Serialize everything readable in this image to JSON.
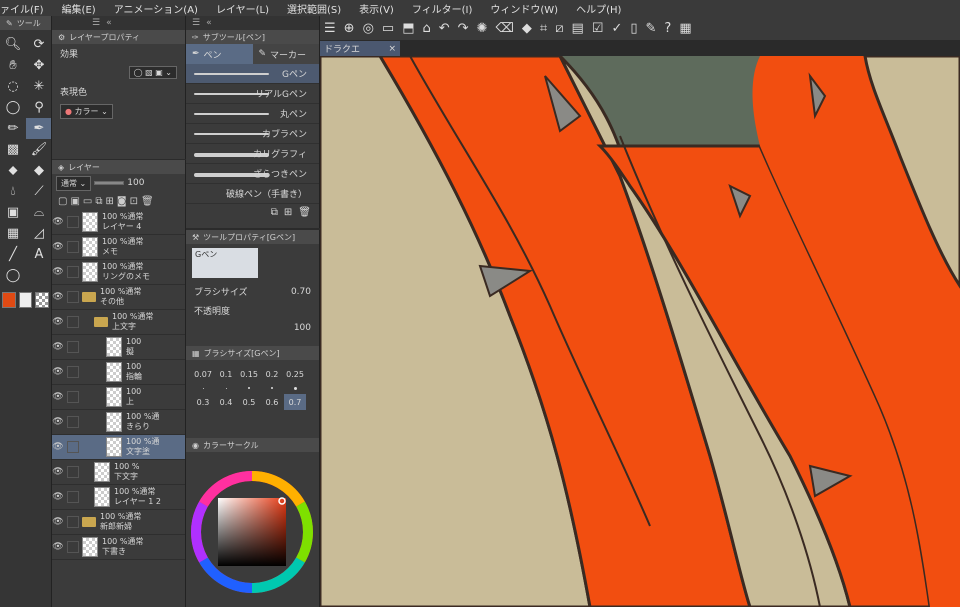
{
  "menu": [
    "ァイル(F)",
    "編集(E)",
    "アニメーション(A)",
    "レイヤー(L)",
    "選択範囲(S)",
    "表示(V)",
    "フィルター(I)",
    "ウィンドウ(W)",
    "ヘルプ(H)"
  ],
  "tool_panel": {
    "title": "ツール"
  },
  "layer_property": {
    "title": "レイヤープロパティ",
    "effect_label": "効果",
    "color_label": "表現色",
    "color_value": "カラー"
  },
  "layer_panel": {
    "title": "レイヤー",
    "blend_mode": "通常",
    "opacity": "100",
    "layers": [
      {
        "line1": "100 %通常",
        "line2": "レイヤー 4",
        "type": "layer",
        "indent": 0
      },
      {
        "line1": "100 %通常",
        "line2": "メモ",
        "type": "layer",
        "indent": 0
      },
      {
        "line1": "100 %通常",
        "line2": "リングのメモ",
        "type": "layer",
        "indent": 0
      },
      {
        "line1": "100 %通常",
        "line2": "その他",
        "type": "folder",
        "indent": 0
      },
      {
        "line1": "100 %通常",
        "line2": "上文字",
        "type": "folder",
        "indent": 1
      },
      {
        "line1": "100",
        "line2": "擬",
        "type": "layer",
        "indent": 2
      },
      {
        "line1": "100",
        "line2": "指輪",
        "type": "layer",
        "indent": 2
      },
      {
        "line1": "100",
        "line2": "上",
        "type": "layer",
        "indent": 2
      },
      {
        "line1": "100 %通",
        "line2": "きらり",
        "type": "layer",
        "indent": 2
      },
      {
        "line1": "100 %通",
        "line2": "文字塗",
        "type": "layer",
        "indent": 2,
        "selected": true
      },
      {
        "line1": "100 %",
        "line2": "下文字",
        "type": "layer",
        "indent": 1
      },
      {
        "line1": "100 %通常",
        "line2": "レイヤー 1 2",
        "type": "layer",
        "indent": 1
      },
      {
        "line1": "100 %通常",
        "line2": "新郎新婦",
        "type": "folder",
        "indent": 0
      },
      {
        "line1": "100 %通常",
        "line2": "下書き",
        "type": "layer",
        "indent": 0
      }
    ]
  },
  "subtool_panel": {
    "title": "サブツール[ペン]",
    "tabs": [
      "ペン",
      "マーカー"
    ],
    "brushes": [
      "Gペン",
      "リアルGペン",
      "丸ペン",
      "カブラペン",
      "カリグラフィ",
      "ざらつきペン",
      "破線ペン（手書き）"
    ]
  },
  "tool_property": {
    "title": "ツールプロパティ[Gペン]",
    "brush_name": "Gペン",
    "size_label": "ブラシサイズ",
    "size_value": "0.70",
    "opacity_label": "不透明度",
    "opacity_value": "100"
  },
  "brush_size_panel": {
    "title": "ブラシサイズ[Gペン]",
    "row1": [
      "0.07",
      "0.1",
      "0.15",
      "0.2",
      "0.25"
    ],
    "row2": [
      "0.3",
      "0.4",
      "0.5",
      "0.6",
      "0.7"
    ],
    "selected": "0.7"
  },
  "color_circle_panel": {
    "title": "カラーサークル"
  },
  "canvas": {
    "tab_label": "ドラクエ"
  },
  "colors": {
    "accent": "#5a6b85",
    "orange": "#f24e10",
    "tan": "#c9bc98",
    "main_color": "#e04a14"
  }
}
